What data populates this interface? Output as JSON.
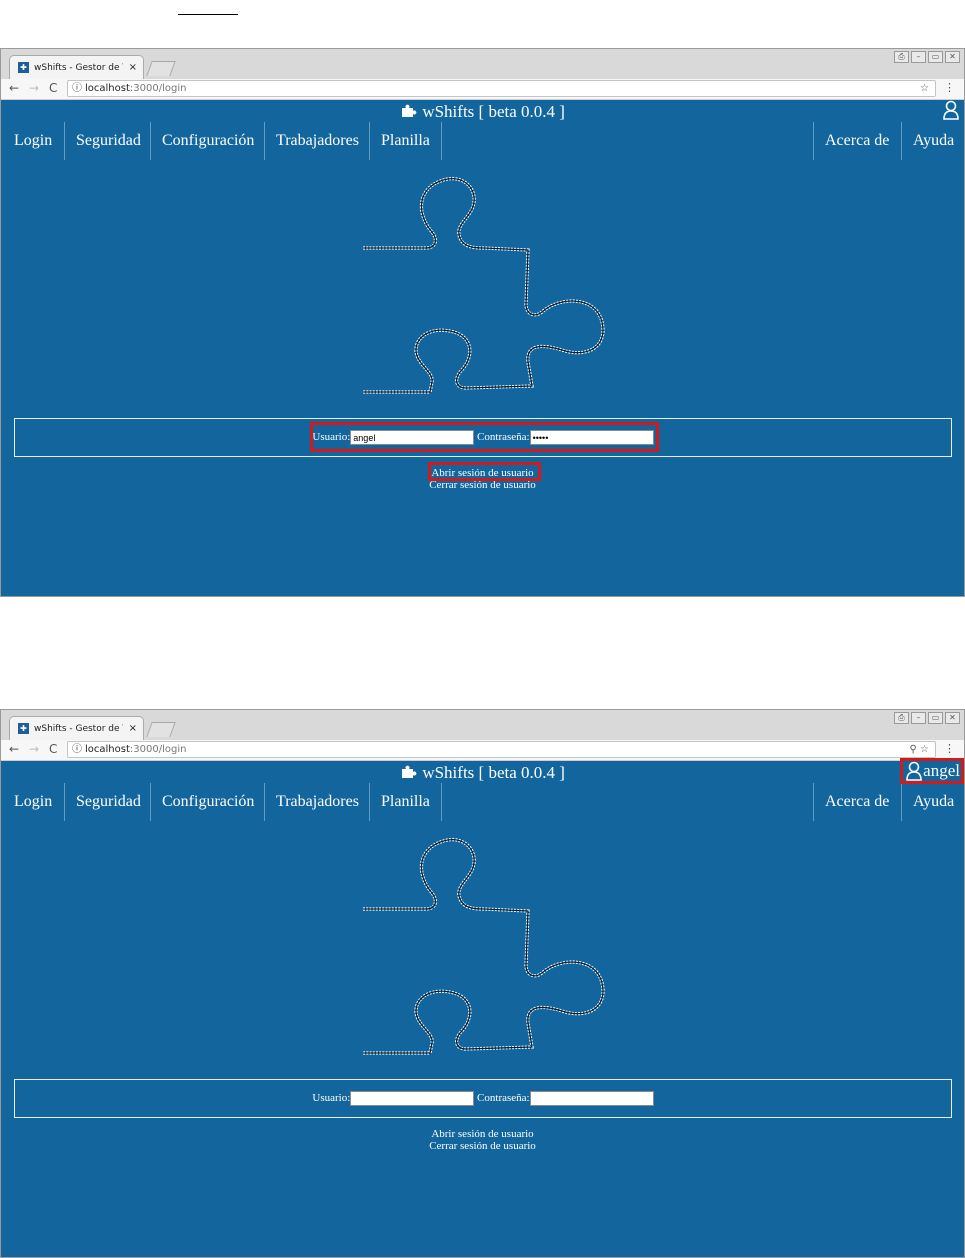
{
  "browser": {
    "tab_title": "wShifts - Gestor de Tu",
    "tab_close": "×",
    "url_host": "localhost",
    "url_path": ":3000/login",
    "window_controls": [
      "⎙",
      "–",
      "▭",
      "✕"
    ]
  },
  "app": {
    "title": "wShifts [ beta 0.0.4 ]",
    "menu_left": [
      "Login",
      "Seguridad",
      "Configuración",
      "Trabajadores",
      "Planilla"
    ],
    "menu_right": [
      "Acerca de",
      "Ayuda"
    ],
    "login": {
      "usuario_label": "Usuario:",
      "contrasena_label": "Contraseña:",
      "open_session": "Abrir sesión de usuario",
      "close_session": "Cerrar sesión de usuario"
    }
  },
  "screens": [
    {
      "usuario_value": "angel",
      "password_value": "•••••",
      "user_label": ""
    },
    {
      "usuario_value": "",
      "password_value": "",
      "user_label": "angel"
    }
  ],
  "colors": {
    "app_bg": "#12669d",
    "highlight": "#d11a1a"
  }
}
